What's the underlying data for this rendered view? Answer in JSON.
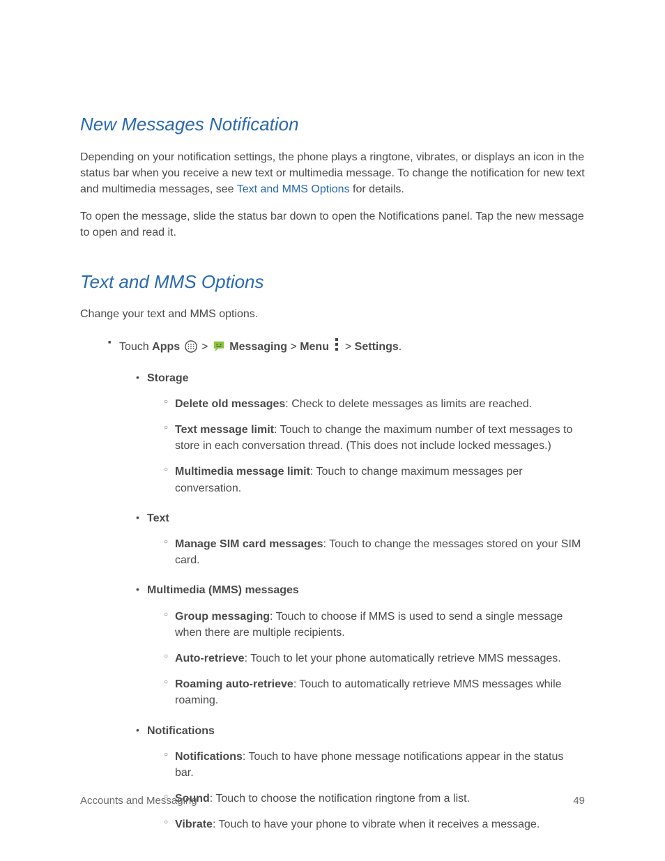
{
  "section1": {
    "heading": "New Messages Notification",
    "para1_part1": "Depending on your notification settings, the phone plays a ringtone, vibrates, or displays an icon in the status bar when you receive a new text or multimedia message. To change the notification for new text and multimedia messages, see ",
    "para1_link": "Text and MMS Options",
    "para1_part2": " for details.",
    "para2": "To open the message, slide the status bar down to open the Notifications panel. Tap the new message to open and read it."
  },
  "section2": {
    "heading": "Text and MMS Options",
    "intro": "Change your text and MMS options.",
    "path": {
      "touch": "Touch ",
      "apps": "Apps",
      "messaging": "Messaging",
      "menu": "Menu",
      "settings": "Settings",
      "sep": " > ",
      "period": "."
    },
    "storage": {
      "title": "Storage",
      "delete_old_b": "Delete old messages",
      "delete_old_t": ": Check to delete messages as limits are reached.",
      "text_limit_b": "Text message limit",
      "text_limit_t": ": Touch to change the maximum number of text messages to store in each conversation thread. (This does not include locked messages.)",
      "mms_limit_b": "Multimedia message limit",
      "mms_limit_t": ": Touch to change maximum messages per conversation."
    },
    "text": {
      "title": "Text",
      "sim_b": "Manage SIM card messages",
      "sim_t": ": Touch to change the messages stored on your SIM card."
    },
    "mms": {
      "title": "Multimedia (MMS) messages",
      "group_b": "Group messaging",
      "group_t": ": Touch to choose if MMS is used to send a single message when there are multiple recipients.",
      "auto_b": "Auto-retrieve",
      "auto_t": ": Touch to let your phone automatically retrieve MMS messages.",
      "roam_b": "Roaming auto-retrieve",
      "roam_t": ": Touch to automatically retrieve MMS messages while roaming."
    },
    "notif": {
      "title": "Notifications",
      "notif_b": "Notifications",
      "notif_t": ": Touch to have phone message notifications appear in the status bar.",
      "sound_b": "Sound",
      "sound_t": ": Touch to choose the notification ringtone from a list.",
      "vibrate_b": "Vibrate",
      "vibrate_t": ": Touch to have your phone to vibrate when it receives a message."
    }
  },
  "footer": {
    "left": "Accounts and Messaging",
    "right": "49"
  },
  "icons": {
    "apps": "apps-icon",
    "messaging": "messaging-icon",
    "menu": "menu-icon"
  }
}
